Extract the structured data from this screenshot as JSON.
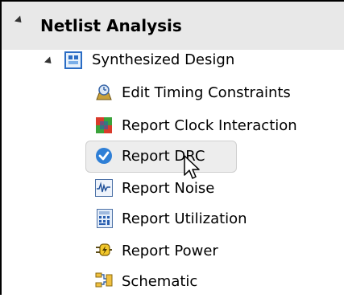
{
  "tree": {
    "root": {
      "label": "Netlist Analysis",
      "expanded": true
    },
    "child": {
      "label": "Synthesized Design",
      "expanded": true,
      "icon": "design-icon"
    },
    "items": [
      {
        "label": "Edit Timing Constraints",
        "icon": "timing-constraints-icon"
      },
      {
        "label": "Report Clock Interaction",
        "icon": "clock-interaction-icon"
      },
      {
        "label": "Report DRC",
        "icon": "drc-icon",
        "selected": true
      },
      {
        "label": "Report Noise",
        "icon": "noise-icon"
      },
      {
        "label": "Report Utilization",
        "icon": "utilization-icon"
      },
      {
        "label": "Report Power",
        "icon": "power-icon"
      },
      {
        "label": "Schematic",
        "icon": "schematic-icon"
      }
    ]
  },
  "colors": {
    "header_bg": "#e8e8e8",
    "selection_bg": "#ededed",
    "drc_blue": "#2f7fd6"
  }
}
